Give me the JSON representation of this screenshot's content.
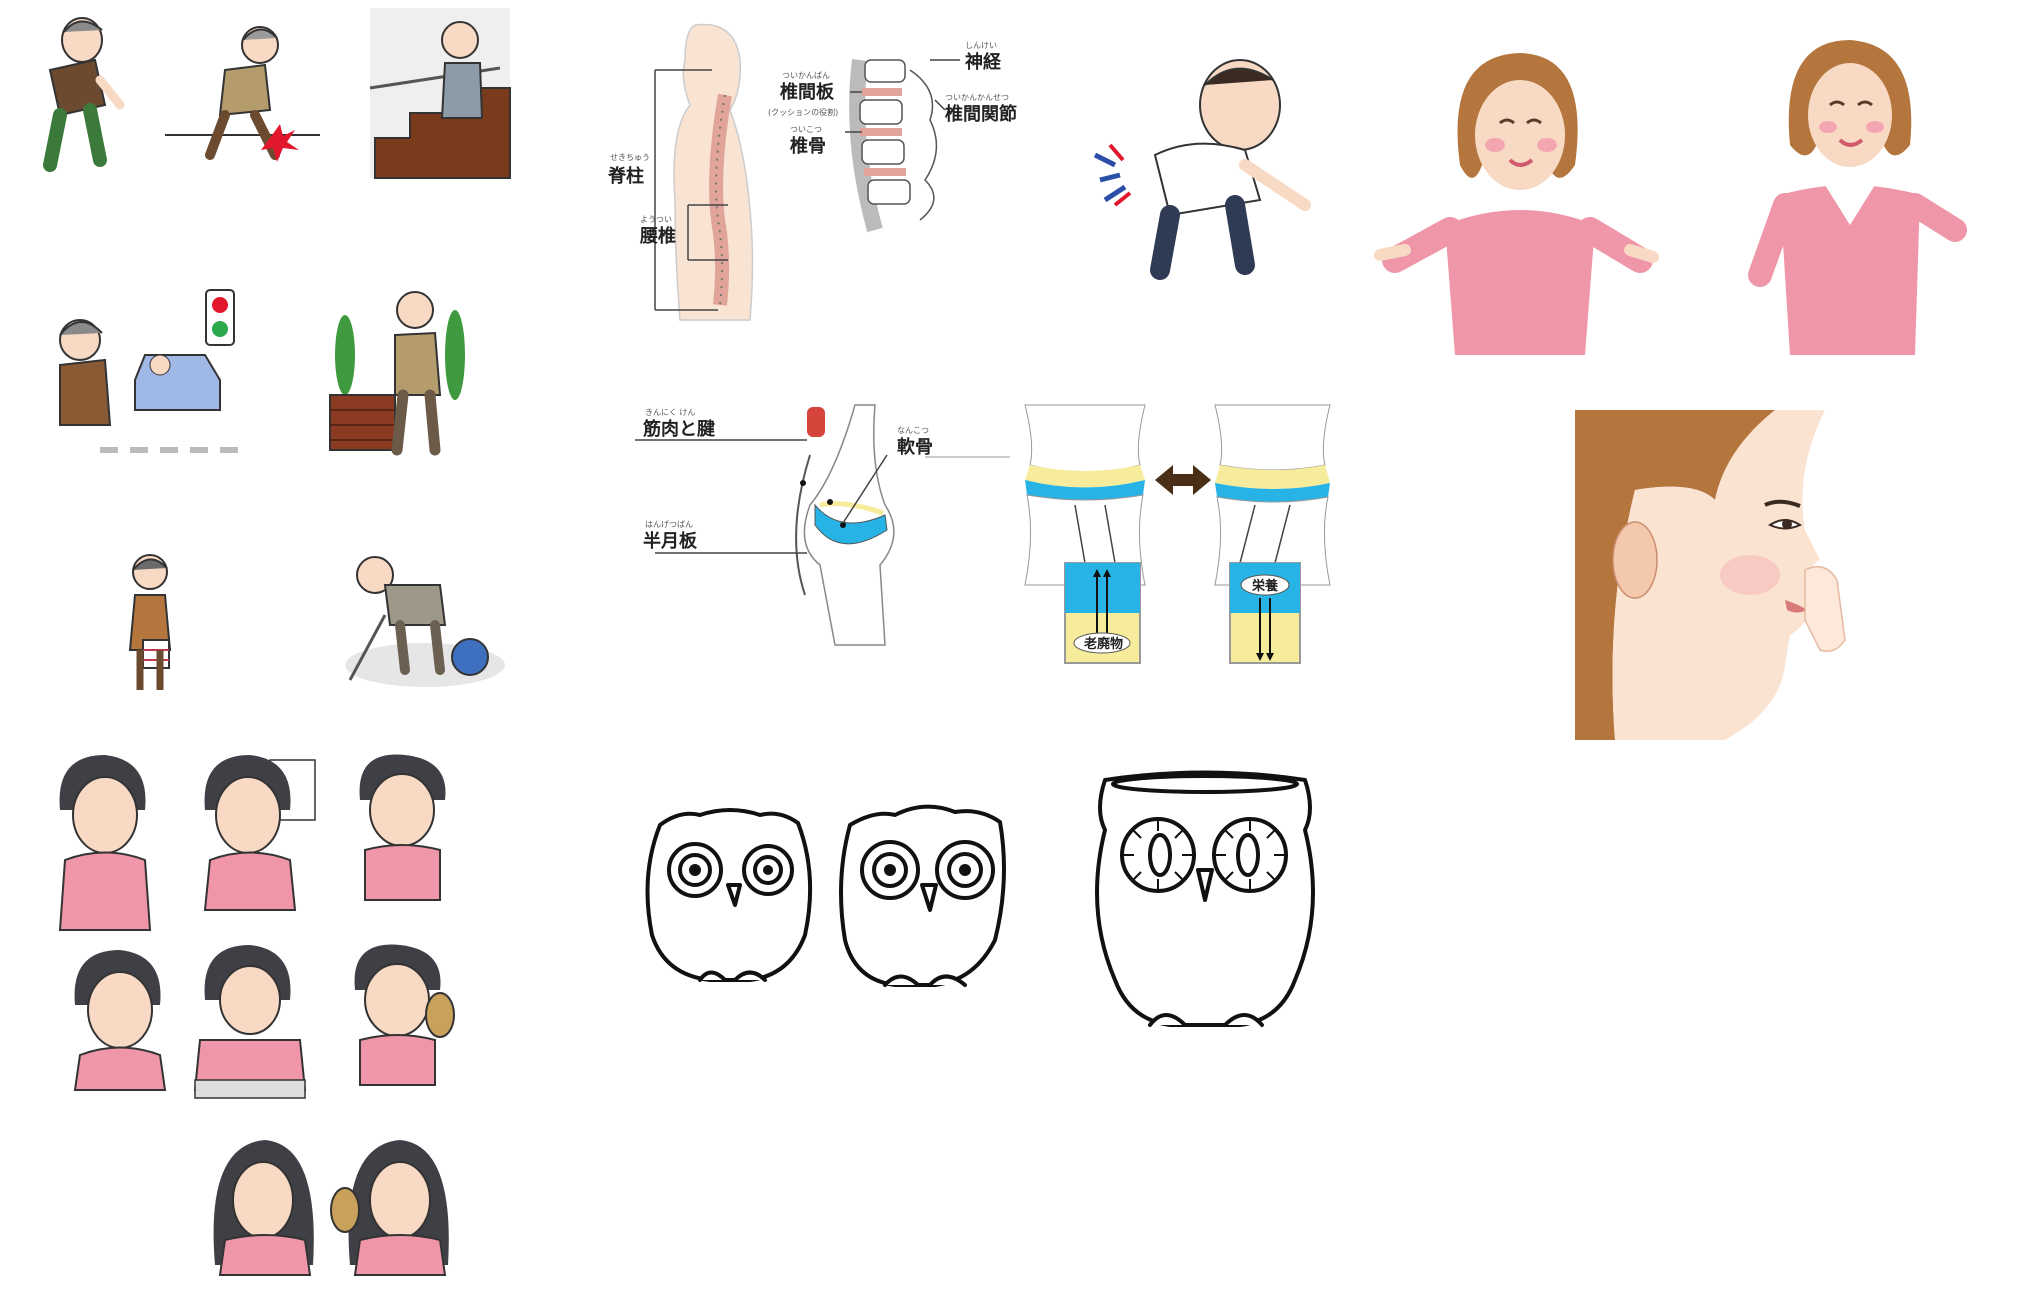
{
  "spine_diagram": {
    "labels": {
      "spine": "脊柱",
      "spine_ruby": "せきちゅう",
      "lumbar": "腰椎",
      "lumbar_ruby": "ようつい",
      "disc": "椎間板",
      "disc_ruby": "ついかんばん",
      "disc_note": "(クッションの役割)",
      "vertebra": "椎骨",
      "vertebra_ruby": "ついこつ",
      "nerve": "神経",
      "nerve_ruby": "しんけい",
      "facet": "椎間関節",
      "facet_ruby": "ついかんかんせつ"
    }
  },
  "knee_diagram": {
    "labels": {
      "muscle": "筋肉と腱",
      "muscle_ruby": "きんにく けん",
      "cartilage": "軟骨",
      "cartilage_ruby": "なんこつ",
      "meniscus": "半月板",
      "meniscus_ruby": "はんげつばん",
      "waste": "老廃物",
      "nutrition": "栄養"
    }
  },
  "colors": {
    "skin": "#f7d9c4",
    "skin_dark": "#e9b99a",
    "pink_top": "#ef97a9",
    "cartilage_yellow": "#f6ec9c",
    "fluid_blue": "#27b3e6",
    "hair_brown": "#b5763e",
    "hair_dark": "#3f3f46"
  }
}
